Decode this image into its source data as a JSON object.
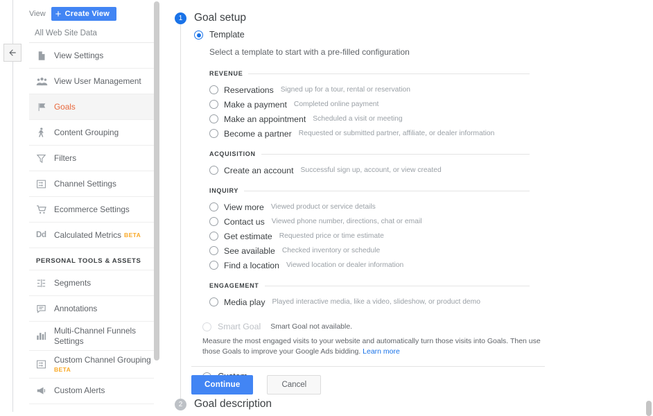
{
  "colors": {
    "accent_blue": "#4285f4",
    "step_active": "#1a73e8",
    "step_idle": "#bdc1c6",
    "active_nav_text": "#e8683c",
    "beta_orange": "#f9a825",
    "link_blue": "#1a73e8"
  },
  "sidebar": {
    "view_label": "View",
    "create_view_button": "Create View",
    "create_view_plus": "+",
    "view_name": "All Web Site Data",
    "items": [
      {
        "label": "View Settings",
        "icon": "document-icon",
        "active": false,
        "beta": false
      },
      {
        "label": "View User Management",
        "icon": "users-icon",
        "active": false,
        "beta": false
      },
      {
        "label": "Goals",
        "icon": "flag-icon",
        "active": true,
        "beta": false
      },
      {
        "label": "Content Grouping",
        "icon": "person-walking-icon",
        "active": false,
        "beta": false
      },
      {
        "label": "Filters",
        "icon": "funnel-icon",
        "active": false,
        "beta": false
      },
      {
        "label": "Channel Settings",
        "icon": "channel-icon",
        "active": false,
        "beta": false
      },
      {
        "label": "Ecommerce Settings",
        "icon": "shopping-cart-icon",
        "active": false,
        "beta": false
      },
      {
        "label": "Calculated Metrics",
        "icon": "dd-icon",
        "active": false,
        "beta": true
      }
    ],
    "personal_section_title": "PERSONAL TOOLS & ASSETS",
    "personal_items": [
      {
        "label": "Segments",
        "icon": "segments-icon",
        "active": false,
        "beta": false
      },
      {
        "label": "Annotations",
        "icon": "speech-bubble-icon",
        "active": false,
        "beta": false
      },
      {
        "label": "Multi-Channel Funnels Settings",
        "icon": "bar-chart-icon",
        "active": false,
        "beta": false
      },
      {
        "label": "Custom Channel Grouping",
        "icon": "channel-icon",
        "active": false,
        "beta": true
      },
      {
        "label": "Custom Alerts",
        "icon": "megaphone-icon",
        "active": false,
        "beta": false
      }
    ],
    "beta_label": "BETA"
  },
  "main": {
    "step1": {
      "number": "1",
      "title": "Goal setup"
    },
    "step2": {
      "number": "2",
      "title": "Goal description"
    },
    "template": {
      "radio_label": "Template",
      "selected": true,
      "hint": "Select a template to start with a pre-filled configuration",
      "groups": [
        {
          "name": "REVENUE",
          "options": [
            {
              "name": "Reservations",
              "desc": "Signed up for a tour, rental or reservation"
            },
            {
              "name": "Make a payment",
              "desc": "Completed online payment"
            },
            {
              "name": "Make an appointment",
              "desc": "Scheduled a visit or meeting"
            },
            {
              "name": "Become a partner",
              "desc": "Requested or submitted partner, affiliate, or dealer information"
            }
          ]
        },
        {
          "name": "ACQUISITION",
          "options": [
            {
              "name": "Create an account",
              "desc": "Successful sign up, account, or view created"
            }
          ]
        },
        {
          "name": "INQUIRY",
          "options": [
            {
              "name": "View more",
              "desc": "Viewed product or service details"
            },
            {
              "name": "Contact us",
              "desc": "Viewed phone number, directions, chat or email"
            },
            {
              "name": "Get estimate",
              "desc": "Requested price or time estimate"
            },
            {
              "name": "See available",
              "desc": "Checked inventory or schedule"
            },
            {
              "name": "Find a location",
              "desc": "Viewed location or dealer information"
            }
          ]
        },
        {
          "name": "ENGAGEMENT",
          "options": [
            {
              "name": "Media play",
              "desc": "Played interactive media, like a video, slideshow, or product demo"
            }
          ]
        }
      ]
    },
    "smart_goal": {
      "label": "Smart Goal",
      "status": "Smart Goal not available.",
      "description": "Measure the most engaged visits to your website and automatically turn those visits into Goals. Then use those Goals to improve your Google Ads bidding.",
      "learn_more": "Learn more"
    },
    "custom": {
      "radio_label": "Custom",
      "selected": false
    },
    "actions": {
      "continue_label": "Continue",
      "cancel_label": "Cancel"
    }
  }
}
